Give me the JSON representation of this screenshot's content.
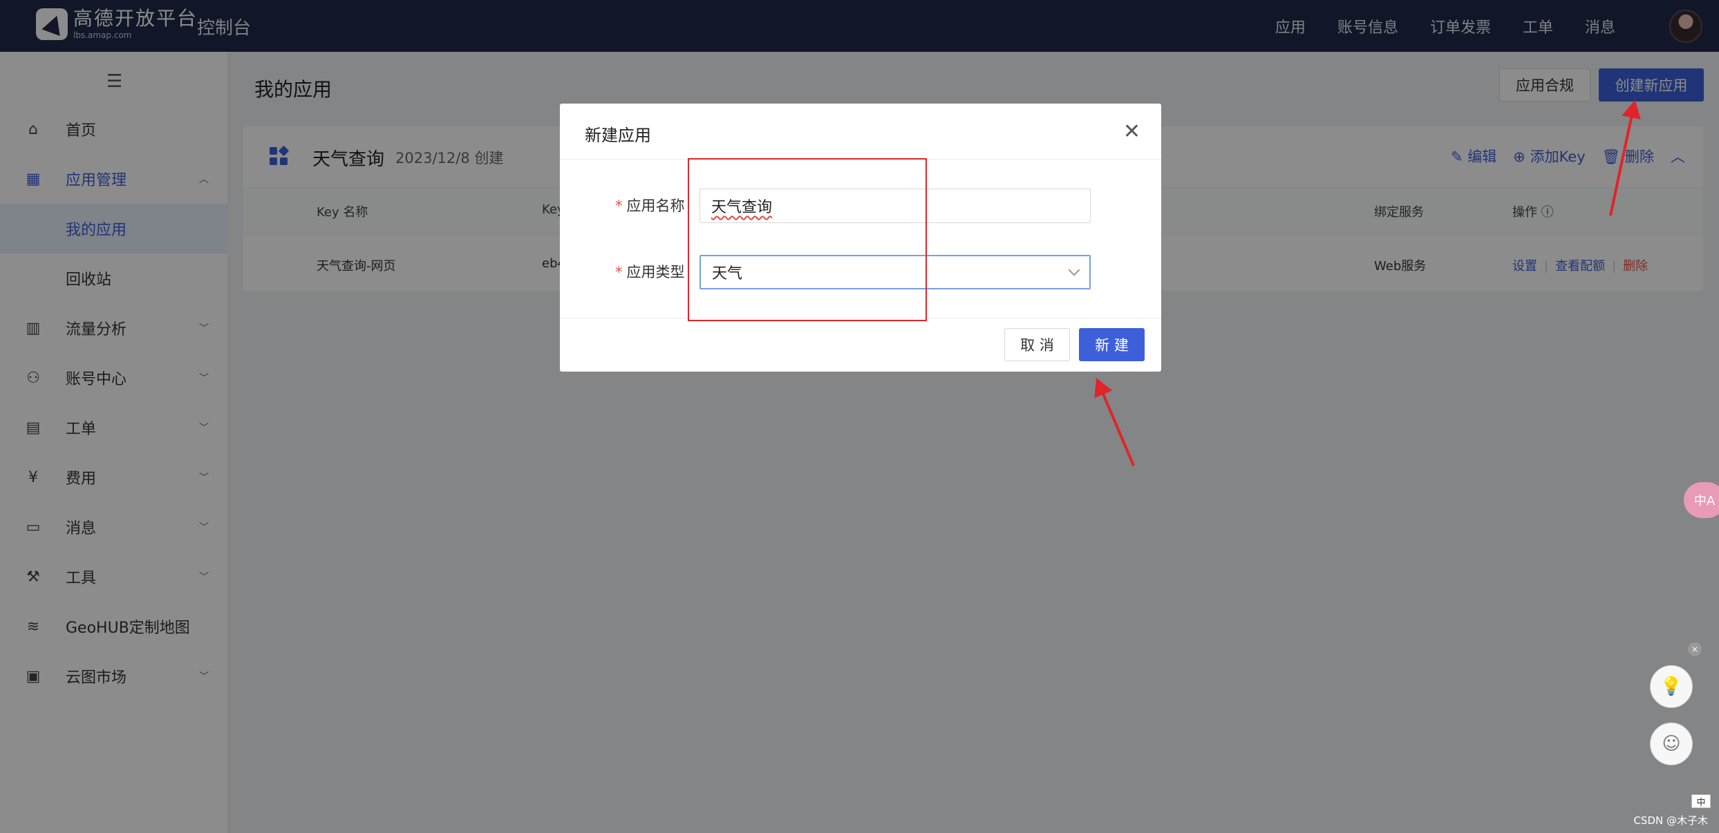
{
  "topbar": {
    "logo_cn": "高德开放平台",
    "logo_en": "lbs.amap.com",
    "console": "控制台",
    "nav": [
      "应用",
      "账号信息",
      "订单发票",
      "工单",
      "消息"
    ]
  },
  "sidebar": {
    "menu_icon": "hamburger-icon",
    "items": [
      {
        "label": "首页",
        "icon": "home-icon"
      },
      {
        "label": "应用管理",
        "icon": "apps-icon"
      },
      {
        "label": "我的应用"
      },
      {
        "label": "回收站"
      },
      {
        "label": "流量分析",
        "icon": "chart-icon"
      },
      {
        "label": "账号中心",
        "icon": "user-icon"
      },
      {
        "label": "工单",
        "icon": "ticket-icon"
      },
      {
        "label": "费用",
        "icon": "yuan-icon"
      },
      {
        "label": "消息",
        "icon": "message-icon"
      },
      {
        "label": "工具",
        "icon": "wrench-icon"
      },
      {
        "label": "GeoHUB定制地图",
        "icon": "layers-icon"
      },
      {
        "label": "云图市场",
        "icon": "store-icon"
      }
    ]
  },
  "main": {
    "title": "我的应用",
    "btn_comply": "应用合规",
    "btn_create": "创建新应用",
    "card": {
      "name": "天气查询",
      "date": "2023/12/8 创建",
      "actions": {
        "edit": "编辑",
        "add_key": "添加Key",
        "delete": "删除"
      },
      "columns": {
        "key_name": "Key 名称",
        "key": "Key",
        "bound_service": "绑定服务",
        "ops": "操作 ⓘ",
        "partial": ")"
      },
      "row": {
        "key_name": "天气查询-网页",
        "key": "eb4",
        "service": "Web服务",
        "set": "设置",
        "quota": "查看配额",
        "del": "删除"
      }
    }
  },
  "modal": {
    "title": "新建应用",
    "name_label": "应用名称",
    "name_value": "天气查询",
    "type_label": "应用类型",
    "type_value": "天气",
    "cancel": "取 消",
    "ok": "新 建"
  },
  "floats": {
    "translate": "中A",
    "x": "×"
  },
  "watermark": "CSDN @木子木",
  "ime": "中",
  "colors": {
    "accent": "#3d5fd9",
    "topbar": "#1f2a4a",
    "annotation": "#e0242a"
  }
}
